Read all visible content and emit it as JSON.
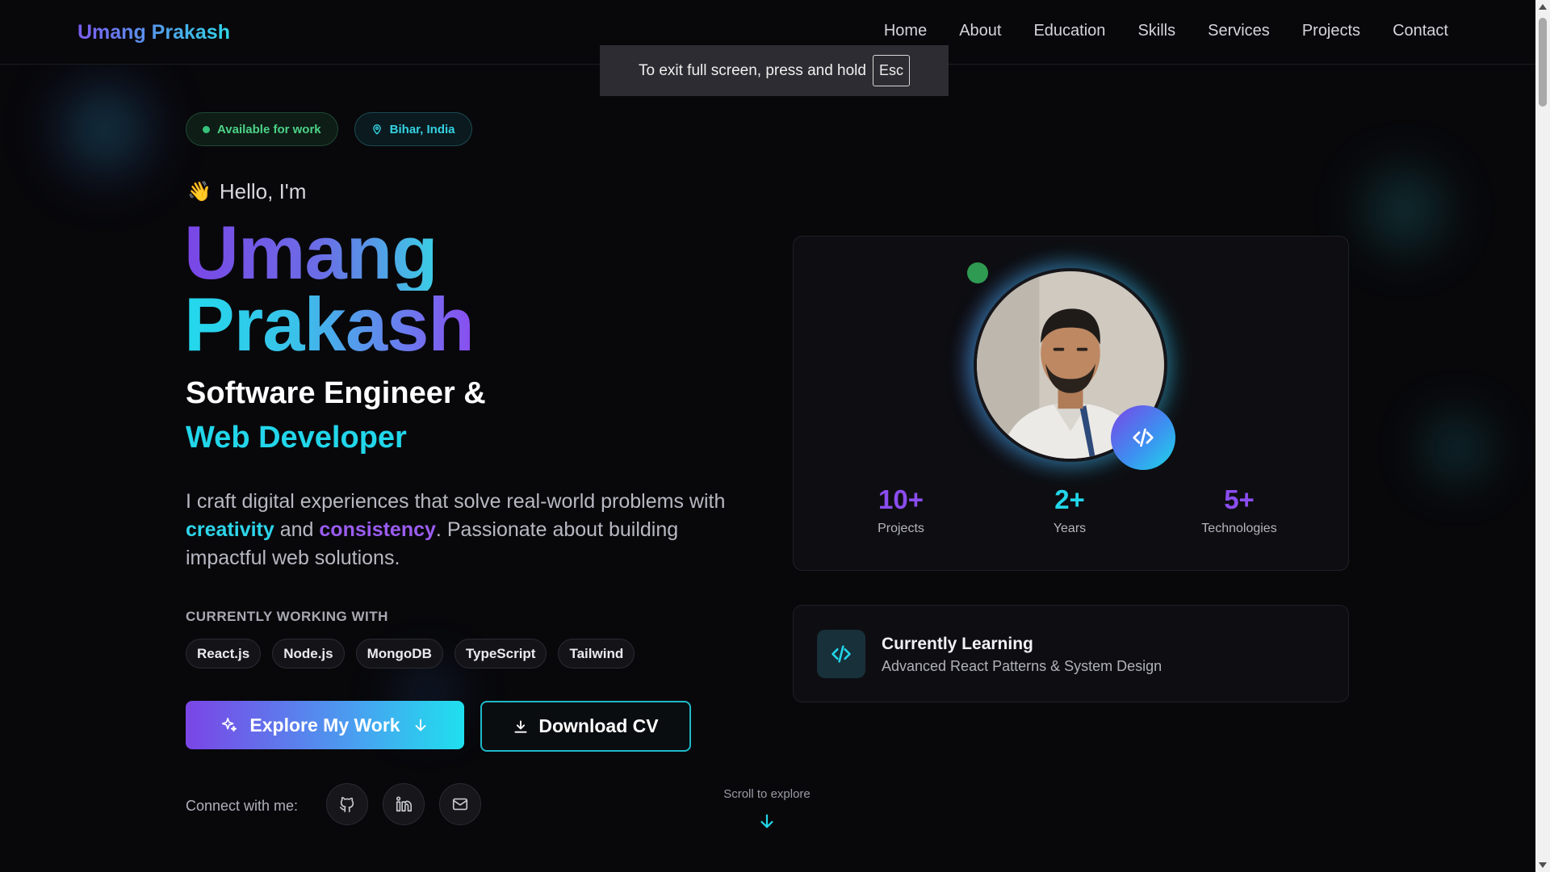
{
  "brand": "Umang Prakash",
  "nav": [
    "Home",
    "About",
    "Education",
    "Skills",
    "Services",
    "Projects",
    "Contact"
  ],
  "toast": {
    "text": "To exit full screen, press and hold",
    "key": "Esc"
  },
  "badges": {
    "available": "Available for work",
    "location": "Bihar, India"
  },
  "hero": {
    "wave": "👋",
    "greeting": "Hello, I'm",
    "first_name": "Umang",
    "last_name": "Prakash",
    "role_line1": "Software Engineer &",
    "role_line2": "Web Developer",
    "desc_part1": "I craft digital experiences that solve real-world problems with ",
    "desc_hl1": "creativity",
    "desc_part2": " and ",
    "desc_hl2": "consistency",
    "desc_part3": ". Passionate about building impactful web solutions."
  },
  "working_with": {
    "label": "CURRENTLY WORKING WITH",
    "chips": [
      "React.js",
      "Node.js",
      "MongoDB",
      "TypeScript",
      "Tailwind"
    ]
  },
  "buttons": {
    "explore": "Explore My Work",
    "download": "Download CV"
  },
  "connect": {
    "label": "Connect with me:",
    "icons": [
      "github-icon",
      "linkedin-icon",
      "mail-icon"
    ]
  },
  "scroll_hint": "Scroll to explore",
  "stats": [
    {
      "value": "10+",
      "label": "Projects"
    },
    {
      "value": "2+",
      "label": "Years"
    },
    {
      "value": "5+",
      "label": "Technologies"
    }
  ],
  "learning": {
    "title": "Currently Learning",
    "subtitle": "Advanced React Patterns & System Design"
  },
  "colors": {
    "background": "#08080b",
    "purple": "#8a4df0",
    "cyan": "#22d6ea",
    "green": "#36c27a"
  }
}
